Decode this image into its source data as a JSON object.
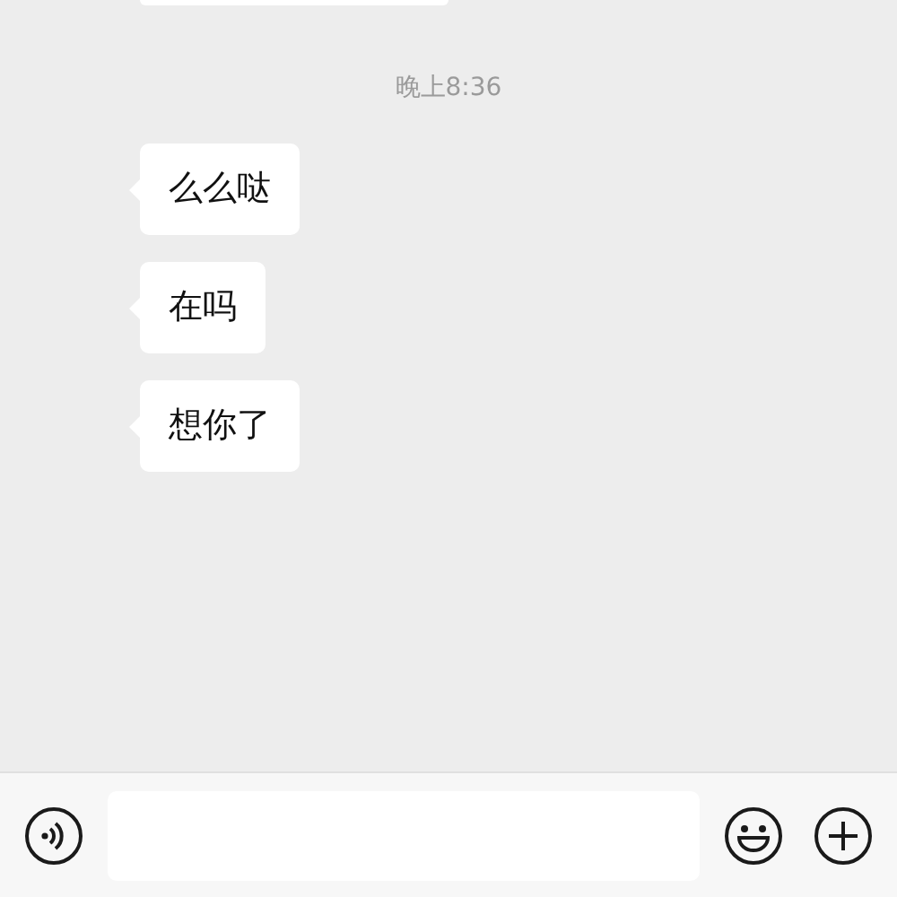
{
  "timestamp": "晚上8:36",
  "messages": [
    {
      "text": "么么哒"
    },
    {
      "text": "在吗"
    },
    {
      "text": "想你了"
    }
  ]
}
